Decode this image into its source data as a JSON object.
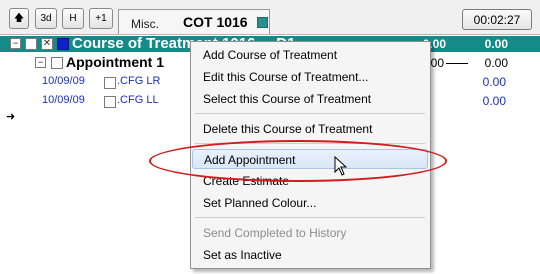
{
  "toolbar": {
    "up_label": "🡅",
    "btn_3d": "3d",
    "btn_h": "H",
    "btn_plus1": "+1",
    "timer": "00:02:27"
  },
  "tab": {
    "misc_label": "Misc.",
    "cot_label": "COT 1016",
    "accent_color": "#2a8f8a"
  },
  "tree": {
    "cot_row": {
      "title": "Course of Treatment 1016 ... D1",
      "value1": "0.00",
      "value2": "0.00",
      "bg_color": "#138b88"
    },
    "appointment_row": {
      "title": "Appointment 1",
      "value1": "0.00",
      "value2": "0.00"
    },
    "items": [
      {
        "date": "10/09/09",
        "code": ".CFG LR",
        "value": "0.00"
      },
      {
        "date": "10/09/09",
        "code": ".CFG LL",
        "value": "0.00"
      }
    ],
    "arrow": "➜"
  },
  "context_menu": {
    "items": [
      {
        "label": "Add Course of Treatment",
        "enabled": true
      },
      {
        "label": "Edit this Course of Treatment...",
        "enabled": true
      },
      {
        "label": "Select this Course of Treatment",
        "enabled": true
      },
      {
        "label": "Delete this Course of Treatment",
        "enabled": true
      },
      {
        "label": "Add Appointment",
        "enabled": true,
        "hovered": true
      },
      {
        "label": "Create Estimate",
        "enabled": true
      },
      {
        "label": "Set Planned Colour...",
        "enabled": true
      },
      {
        "label": "Send Completed to History",
        "enabled": false
      },
      {
        "label": "Set as Inactive",
        "enabled": true
      }
    ],
    "highlight_color": "#d21c1c"
  }
}
